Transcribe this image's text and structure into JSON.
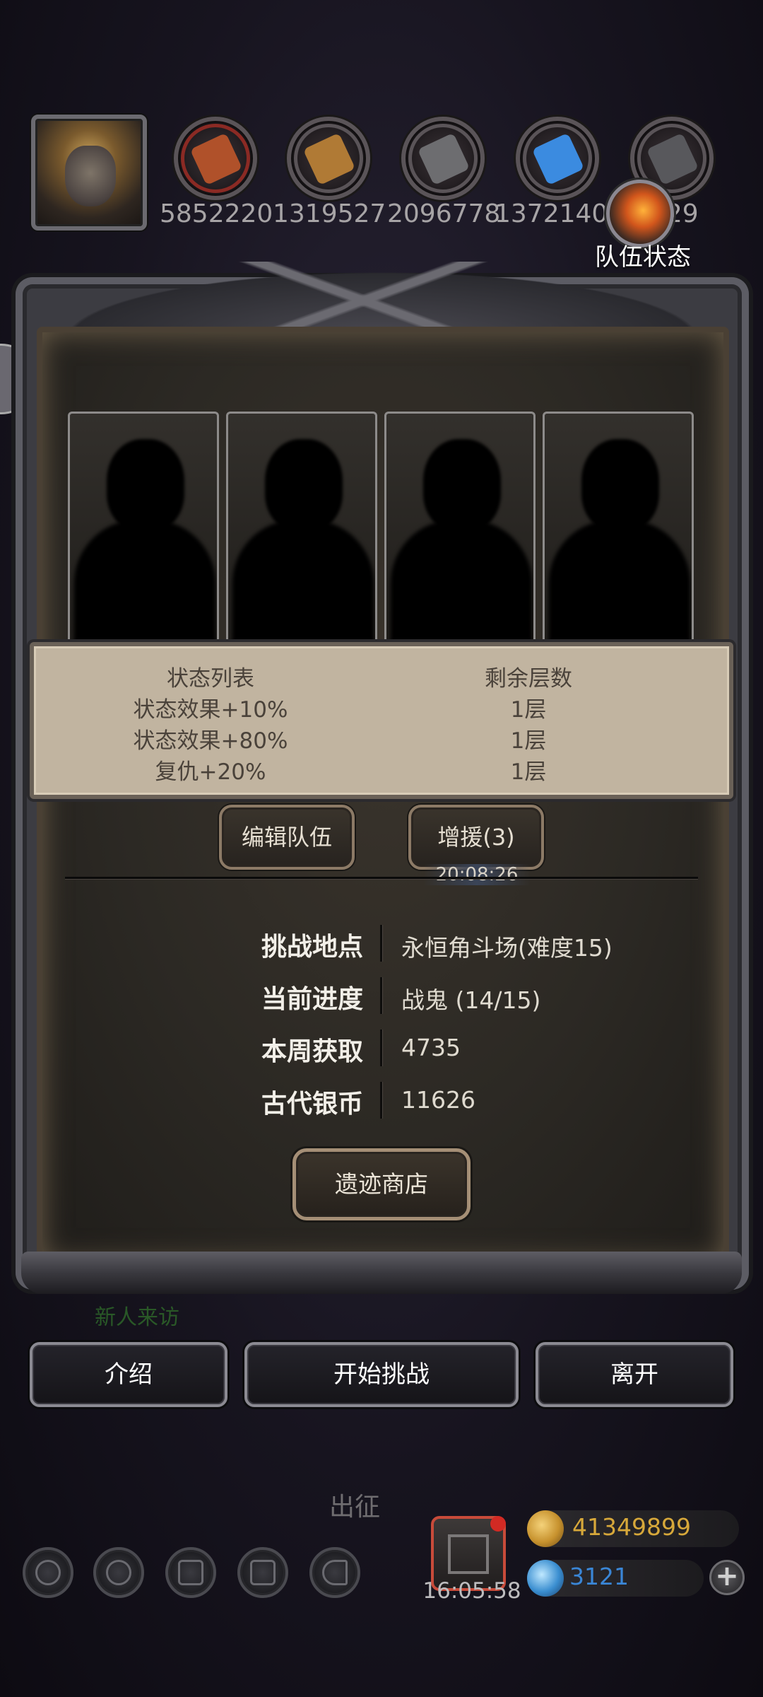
{
  "resources": [
    {
      "icon": "meat-icon",
      "value": "5852220",
      "color": "#b0512a"
    },
    {
      "icon": "wood-icon",
      "value": "1319527",
      "color": "#b07a35"
    },
    {
      "icon": "iron-icon",
      "value": "2096778",
      "color": "#6d6d70"
    },
    {
      "icon": "crystal-icon",
      "value": "1372140",
      "color": "#3b8be0"
    },
    {
      "icon": "stone-icon",
      "value": "029",
      "color": "#58585c"
    }
  ],
  "team_status": {
    "label": "队伍状态"
  },
  "status_table": {
    "headers": [
      "状态列表",
      "剩余层数"
    ],
    "rows": [
      [
        "状态效果+10%",
        "1层"
      ],
      [
        "状态效果+80%",
        "1层"
      ],
      [
        "复仇+20%",
        "1层"
      ]
    ]
  },
  "buttons": {
    "edit_team": "编辑队伍",
    "reinforce": "增援(3)",
    "relic_shop": "遗迹商店",
    "intro": "介绍",
    "start_challenge": "开始挑战",
    "leave": "离开"
  },
  "timer": "20:08:26",
  "info": [
    {
      "label": "挑战地点",
      "value": "永恒角斗场(难度15)"
    },
    {
      "label": "当前进度",
      "value": "战鬼 (14/15)"
    },
    {
      "label": "本周获取",
      "value": "4735"
    },
    {
      "label": "古代银币",
      "value": "11626"
    }
  ],
  "background_text": {
    "faded_notice": "新人来访",
    "expedition": "出征"
  },
  "bottom_bar": {
    "gift_timer": "16:05:58",
    "gold": "41349899",
    "gems": "3121"
  },
  "colors": {
    "gold_text": "#d7a83a",
    "gem_text": "#3a86d6"
  }
}
